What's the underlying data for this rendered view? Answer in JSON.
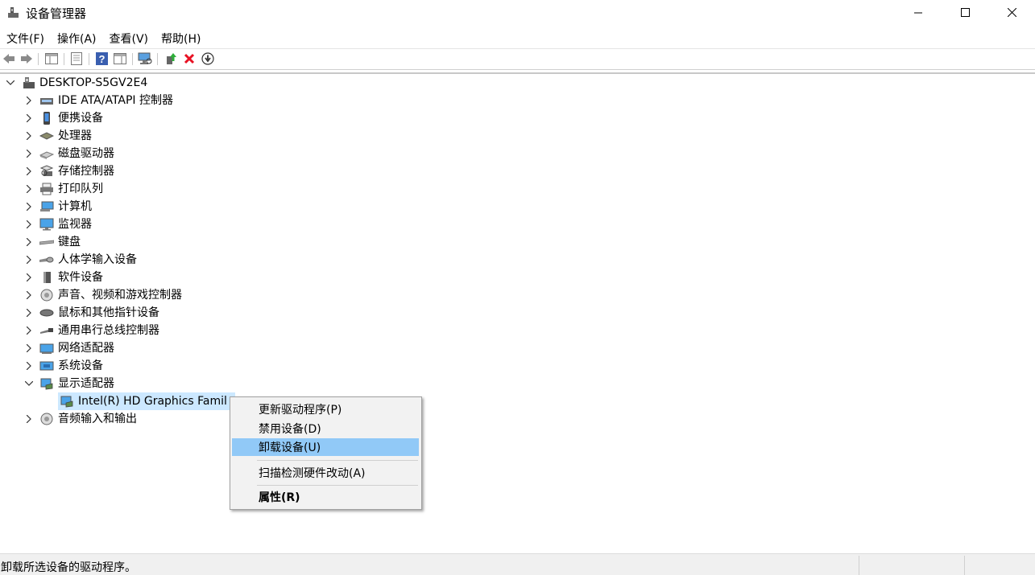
{
  "window": {
    "title": "设备管理器",
    "icon": "device-manager-icon"
  },
  "menu": [
    "文件(F)",
    "操作(A)",
    "查看(V)",
    "帮助(H)"
  ],
  "toolbar": {
    "icons": [
      "back-arrow-icon",
      "forward-arrow-icon",
      "show-hide-console-tree-icon",
      "properties-icon",
      "help-icon",
      "action-pane-icon",
      "scan-hardware-icon",
      "update-driver-icon",
      "uninstall-icon",
      "download-driver-icon"
    ]
  },
  "tree": {
    "root": "DESKTOP-S5GV2E4",
    "categories": [
      {
        "label": "IDE ATA/ATAPI 控制器",
        "icon": "ide-controller-icon"
      },
      {
        "label": "便携设备",
        "icon": "portable-device-icon"
      },
      {
        "label": "处理器",
        "icon": "processor-icon"
      },
      {
        "label": "磁盘驱动器",
        "icon": "disk-drive-icon"
      },
      {
        "label": "存储控制器",
        "icon": "storage-controller-icon"
      },
      {
        "label": "打印队列",
        "icon": "print-queue-icon"
      },
      {
        "label": "计算机",
        "icon": "computer-icon"
      },
      {
        "label": "监视器",
        "icon": "monitor-icon"
      },
      {
        "label": "键盘",
        "icon": "keyboard-icon"
      },
      {
        "label": "人体学输入设备",
        "icon": "hid-icon"
      },
      {
        "label": "软件设备",
        "icon": "software-device-icon"
      },
      {
        "label": "声音、视频和游戏控制器",
        "icon": "sound-controller-icon"
      },
      {
        "label": "鼠标和其他指针设备",
        "icon": "mouse-icon"
      },
      {
        "label": "通用串行总线控制器",
        "icon": "usb-controller-icon"
      },
      {
        "label": "网络适配器",
        "icon": "network-adapter-icon"
      },
      {
        "label": "系统设备",
        "icon": "system-device-icon"
      },
      {
        "label": "显示适配器",
        "icon": "display-adapter-icon"
      }
    ],
    "selected_child": "Intel(R) HD Graphics Famil",
    "last_category": "音频输入和输出"
  },
  "context_menu": {
    "items": [
      "更新驱动程序(P)",
      "禁用设备(D)",
      "卸载设备(U)",
      "扫描检测硬件改动(A)",
      "属性(R)"
    ],
    "highlighted": "卸载设备(U)",
    "highlight_color": "#91c9f7"
  },
  "status": {
    "text": "卸载所选设备的驱动程序。"
  },
  "colors": {
    "selection": "#cce8ff",
    "accent_blue": "#1e88e5",
    "error_red": "#e81123"
  }
}
